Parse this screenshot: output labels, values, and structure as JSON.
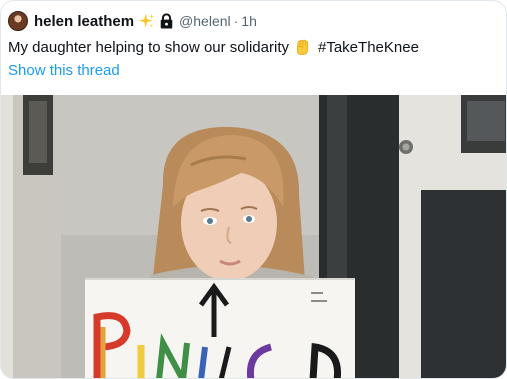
{
  "tweet": {
    "author_name": "helen leathem",
    "handle": "@helenl",
    "separator": "·",
    "timestamp": "1h",
    "icons": {
      "avatar": "profile-photo",
      "verified_style": "sparkles-icon",
      "protected": "lock-icon",
      "emoji": "raised-fist-icon"
    },
    "text_before": "My daughter helping to show our solidarity",
    "hashtag": "#TakeTheKnee",
    "show_thread_label": "Show this thread",
    "colors": {
      "link": "#1d9bf0",
      "secondary": "#536471",
      "primary_text": "#0f1419"
    }
  }
}
